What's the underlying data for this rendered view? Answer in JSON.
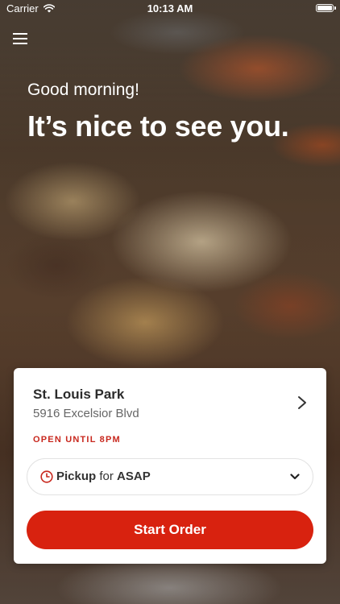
{
  "status_bar": {
    "carrier": "Carrier",
    "time": "10:13 AM",
    "wifi_icon": "wifi-icon",
    "battery_icon": "battery-icon"
  },
  "header": {
    "menu_icon": "hamburger-menu-icon"
  },
  "hero": {
    "greeting": "Good morning!",
    "headline": "It’s nice to see you."
  },
  "location_card": {
    "name": "St. Louis Park",
    "address": "5916 Excelsior Blvd",
    "status": "OPEN UNTIL 8PM",
    "chevron_icon": "chevron-right-icon",
    "order_type": {
      "icon": "clock-icon",
      "method": "Pickup",
      "connector": "for",
      "time": "ASAP",
      "dropdown_icon": "chevron-down-icon"
    },
    "start_button_label": "Start Order"
  },
  "colors": {
    "accent": "#d8220f",
    "status_red": "#c8281e"
  }
}
